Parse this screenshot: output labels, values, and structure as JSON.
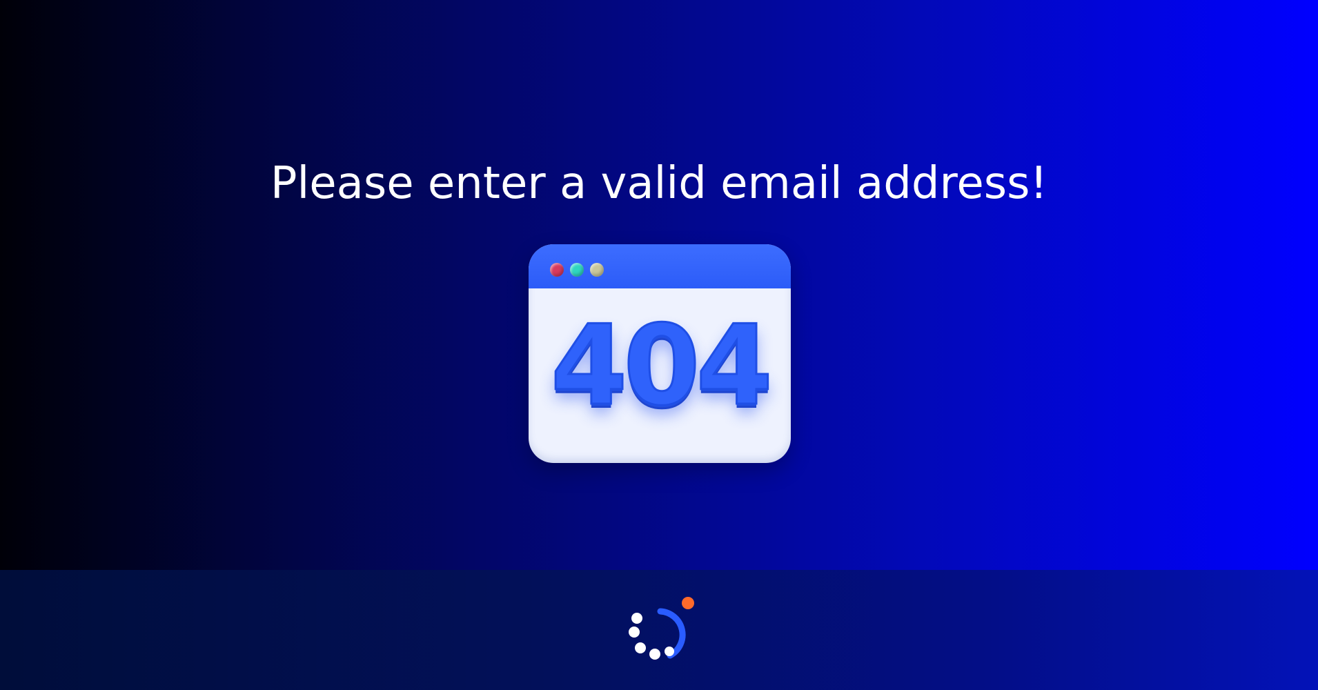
{
  "page": {
    "message": "Please enter a valid email address!"
  },
  "illustration": {
    "error_code": "404",
    "window_dots": [
      "red",
      "green",
      "yellow"
    ]
  },
  "footer": {
    "logo": "loading-spinner-logo"
  },
  "colors": {
    "accent_blue": "#2f62fb",
    "logo_orange": "#ff6a2b",
    "gradient_start": "#000008",
    "gradient_end": "#0000ff"
  }
}
